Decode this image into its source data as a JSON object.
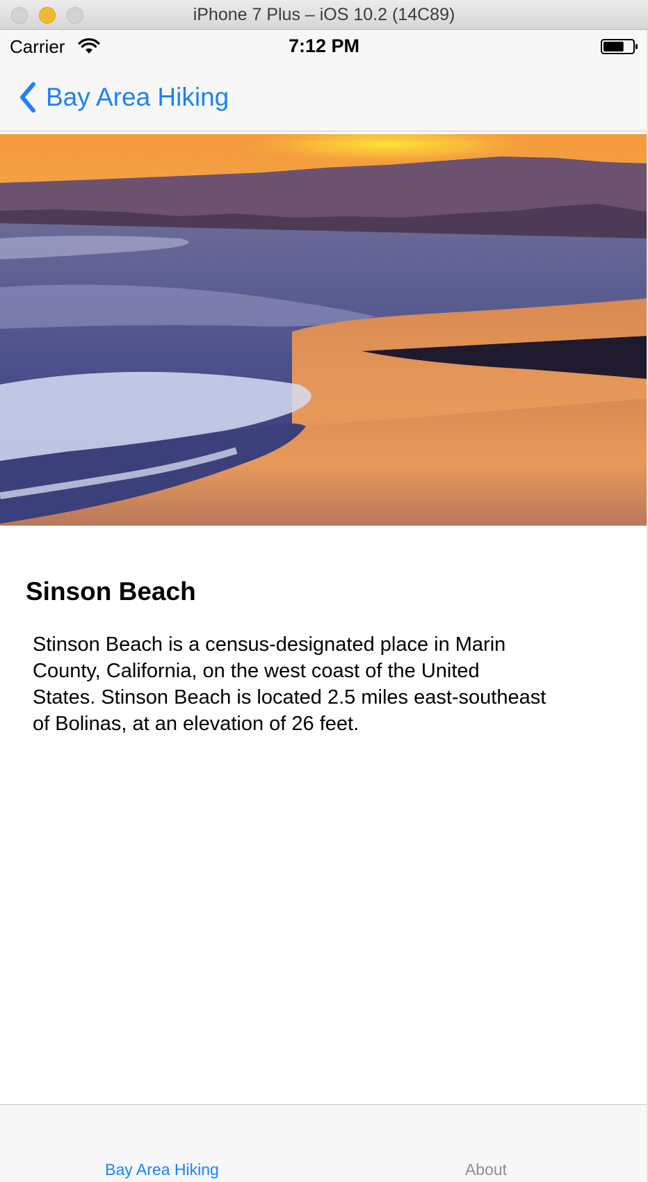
{
  "window": {
    "title": "iPhone 7 Plus – iOS 10.2 (14C89)",
    "controls": [
      "close",
      "minimize",
      "zoom"
    ]
  },
  "status_bar": {
    "carrier": "Carrier",
    "time": "7:12 PM",
    "icons": [
      "wifi-icon",
      "battery-icon"
    ],
    "battery_level": 0.7
  },
  "nav": {
    "back_label": "Bay Area Hiking",
    "back_icon": "chevron-left-icon"
  },
  "hero": {
    "alt": "sunset-beach-photo"
  },
  "detail": {
    "title": "Sinson Beach",
    "description": "Stinson Beach is a census-designated place in Marin County, California, on the west coast of the United States. Stinson Beach is located 2.5 miles east-southeast of Bolinas, at an elevation of 26 feet."
  },
  "tabs": [
    {
      "label": "Bay Area Hiking",
      "selected": true
    },
    {
      "label": "About",
      "selected": false
    }
  ],
  "colors": {
    "tint": "#1a82fb",
    "inactive_tab": "#8e8e93",
    "bar_background": "#f7f7f7"
  }
}
